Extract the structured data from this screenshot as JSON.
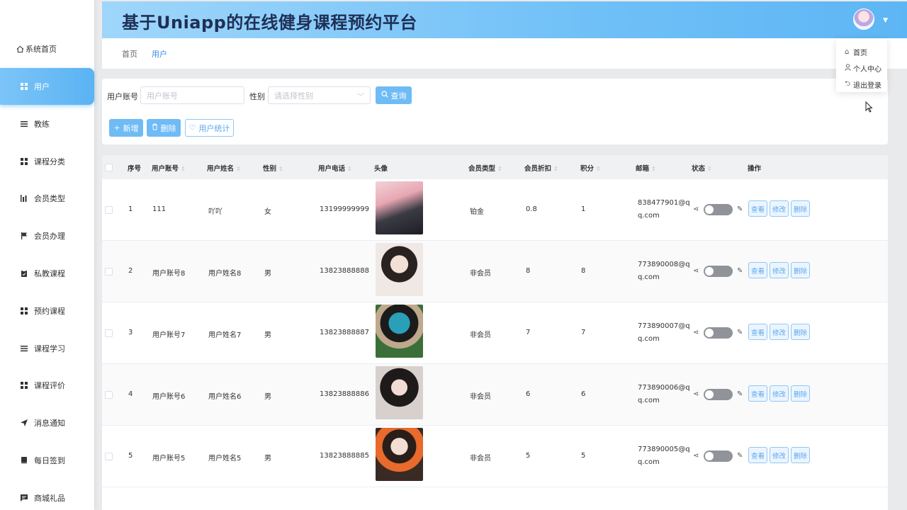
{
  "app": {
    "title": "基于Uniapp的在线健身课程预约平台"
  },
  "sidebar": {
    "home_label": "系统首页",
    "items": [
      {
        "label": "用户",
        "icon": "grid-icon",
        "active": true
      },
      {
        "label": "教练",
        "icon": "list-icon"
      },
      {
        "label": "课程分类",
        "icon": "grid-icon"
      },
      {
        "label": "会员类型",
        "icon": "chart-icon"
      },
      {
        "label": "会员办理",
        "icon": "flag-icon"
      },
      {
        "label": "私教课程",
        "icon": "clipboard-icon"
      },
      {
        "label": "预约课程",
        "icon": "grid-icon"
      },
      {
        "label": "课程学习",
        "icon": "list-icon"
      },
      {
        "label": "课程评价",
        "icon": "grid-icon"
      },
      {
        "label": "消息通知",
        "icon": "send-icon"
      },
      {
        "label": "每日签到",
        "icon": "book-icon"
      },
      {
        "label": "商城礼品",
        "icon": "message-icon"
      }
    ]
  },
  "breadcrumb": {
    "home": "首页",
    "current": "用户"
  },
  "user_menu": {
    "items": [
      "首页",
      "个人中心",
      "退出登录"
    ]
  },
  "search": {
    "account_label": "用户账号",
    "account_placeholder": "用户账号",
    "gender_label": "性别",
    "gender_placeholder": "请选择性别",
    "query_label": "查询"
  },
  "actions": {
    "add": "新增",
    "delete": "删除",
    "stats": "用户统计"
  },
  "table": {
    "columns": [
      "序号",
      "用户账号",
      "用户姓名",
      "性别",
      "用户电话",
      "头像",
      "会员类型",
      "会员折扣",
      "积分",
      "邮箱",
      "状态",
      "操作"
    ],
    "row_buttons": {
      "view": "查看",
      "edit": "修改",
      "delete": "删除"
    },
    "rows": [
      {
        "index": "1",
        "account": "111",
        "name": "吖吖",
        "gender": "女",
        "phone": "13199999999",
        "member_type": "铂金",
        "discount": "0.8",
        "points": "1",
        "email": "838477901@qq.com"
      },
      {
        "index": "2",
        "account": "用户账号8",
        "name": "用户姓名8",
        "gender": "男",
        "phone": "13823888888",
        "member_type": "非会员",
        "discount": "8",
        "points": "8",
        "email": "773890008@qq.com"
      },
      {
        "index": "3",
        "account": "用户账号7",
        "name": "用户姓名7",
        "gender": "男",
        "phone": "13823888887",
        "member_type": "非会员",
        "discount": "7",
        "points": "7",
        "email": "773890007@qq.com"
      },
      {
        "index": "4",
        "account": "用户账号6",
        "name": "用户姓名6",
        "gender": "男",
        "phone": "13823888886",
        "member_type": "非会员",
        "discount": "6",
        "points": "6",
        "email": "773890006@qq.com"
      },
      {
        "index": "5",
        "account": "用户账号5",
        "name": "用户姓名5",
        "gender": "男",
        "phone": "13823888885",
        "member_type": "非会员",
        "discount": "5",
        "points": "5",
        "email": "773890005@qq.com"
      }
    ]
  },
  "colors": {
    "accent": "#5ab3f3",
    "header_start": "#9fd6fb",
    "header_end": "#5db6f4",
    "title": "#1f2f55"
  }
}
